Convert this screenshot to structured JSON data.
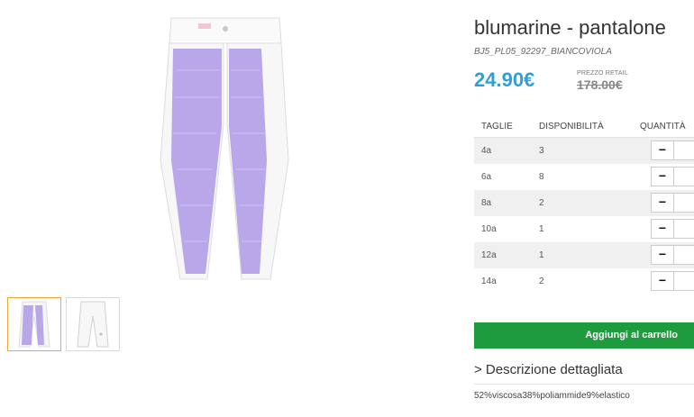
{
  "product": {
    "title": "blumarine - pantalone",
    "sku": "BJ5_PL05_92297_BIANCOVIOLA",
    "price": "24.90€",
    "retail_label": "PREZZO RETAIL",
    "retail_price": "178.00€"
  },
  "table": {
    "headers": [
      "TAGLIE",
      "DISPONIBILITÀ",
      "QUANTITÀ"
    ],
    "rows": [
      {
        "size": "4a",
        "availability": "3"
      },
      {
        "size": "6a",
        "availability": "8"
      },
      {
        "size": "8a",
        "availability": "2"
      },
      {
        "size": "10a",
        "availability": "1"
      },
      {
        "size": "12a",
        "availability": "1"
      },
      {
        "size": "14a",
        "availability": "2"
      }
    ],
    "minus_label": "−"
  },
  "add_to_cart_label": "Aggiungi al carrello",
  "description": {
    "toggle_label": "> Descrizione dettagliata",
    "composition": "52%viscosa38%poliammide9%elastico"
  },
  "colors": {
    "price": "#2f9fd8",
    "cart_button": "#1e9b3e",
    "thumb_active_border": "#f0a43a",
    "fabric_lilac": "#b6a3e8"
  }
}
